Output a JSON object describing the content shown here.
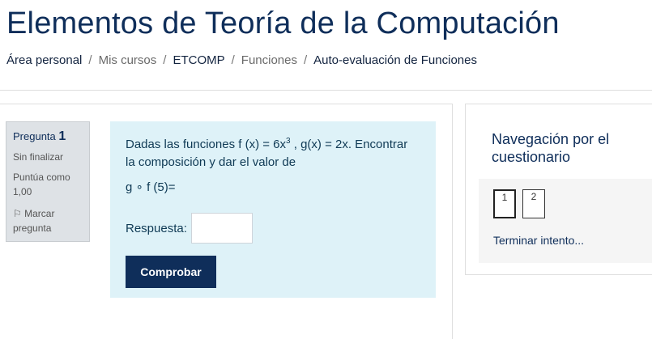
{
  "page": {
    "title": "Elementos de Teoría de la Computación"
  },
  "breadcrumb": [
    {
      "label": "Área personal"
    },
    {
      "label": "Mis cursos"
    },
    {
      "label": "ETCOMP"
    },
    {
      "label": "Funciones"
    },
    {
      "label": "Auto-evaluación de Funciones"
    }
  ],
  "question": {
    "prefix": "Pregunta",
    "number": "1",
    "state": "Sin finalizar",
    "grade": "Puntúa como 1,00",
    "flag_label": "Marcar pregunta",
    "text_part1": "Dadas las funciones f (x) = 6x",
    "text_exp": "3",
    "text_part2": " , g(x) = 2x. Encontrar la composición y dar el valor de",
    "expression": "g ∘ f (5)=",
    "answer_label": "Respuesta:",
    "answer_value": "",
    "check_label": "Comprobar"
  },
  "navigation": {
    "title": "Navegación por el cuestionario",
    "buttons": [
      "1",
      "2"
    ],
    "current": "1",
    "finish_label": "Terminar intento..."
  },
  "colors": {
    "brand": "#0f2e5a",
    "question_bg": "#def2f8",
    "info_bg": "#dee2e6"
  }
}
